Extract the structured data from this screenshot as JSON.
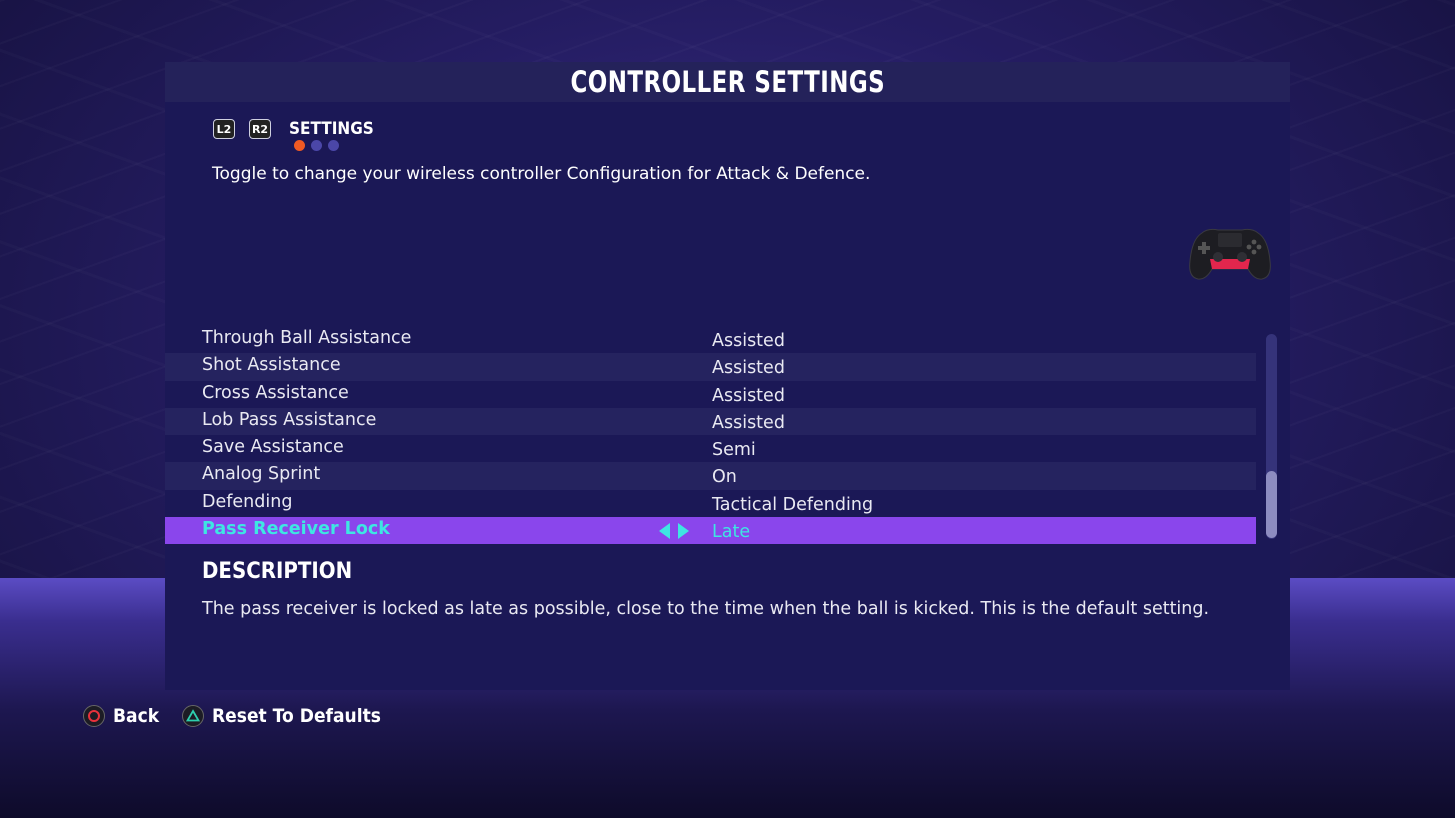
{
  "header": {
    "title": "CONTROLLER SETTINGS"
  },
  "tabs": {
    "left_shoulder": "L2",
    "right_shoulder": "R2",
    "label": "SETTINGS",
    "page_count": 3,
    "active_page": 1
  },
  "subtitle": "Toggle to change your wireless controller Configuration for Attack & Defence.",
  "settings": [
    {
      "name": "Through Ball Assistance",
      "value": "Assisted"
    },
    {
      "name": "Shot Assistance",
      "value": "Assisted"
    },
    {
      "name": "Cross Assistance",
      "value": "Assisted"
    },
    {
      "name": "Lob Pass Assistance",
      "value": "Assisted"
    },
    {
      "name": "Save Assistance",
      "value": "Semi"
    },
    {
      "name": "Analog Sprint",
      "value": "On"
    },
    {
      "name": "Defending",
      "value": "Tactical Defending"
    },
    {
      "name": "Pass Receiver Lock",
      "value": "Late"
    }
  ],
  "selected_index": 7,
  "description": {
    "heading": "DESCRIPTION",
    "text": "The pass receiver is locked as late as possible, close to the time when the ball is kicked. This is the default setting."
  },
  "footer": {
    "back": "Back",
    "reset": "Reset To Defaults"
  },
  "icons": {
    "back": "circle-button-icon",
    "reset": "triangle-button-icon",
    "controller": "gamepad-icon"
  },
  "colors": {
    "accent_orange": "#f05a23",
    "selection": "#8a46ec",
    "selection_text": "#3ee6e2",
    "circle_button": "#e8323c",
    "triangle_button": "#2ecfae"
  }
}
